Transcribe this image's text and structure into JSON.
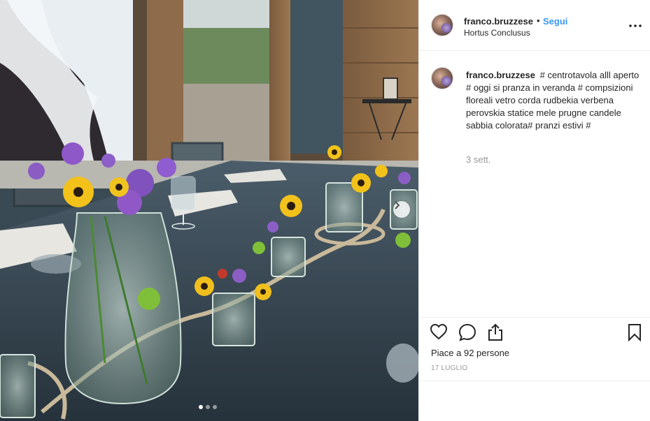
{
  "post": {
    "username": "franco.bruzzese",
    "separator": "•",
    "follow_label": "Segui",
    "location": "Hortus Conclusus",
    "more_icon": "ellipsis-icon"
  },
  "caption": {
    "username": "franco.bruzzese",
    "text": "# centrotavola alll aperto # oggi si pranza in veranda # compsizioni floreali vetro corda rudbekia verbena perovskia statice mele prugne candele sabbia colorata# pranzi estivi #",
    "age": "3 sett."
  },
  "actions": {
    "like_icon": "heart-icon",
    "comment_icon": "comment-icon",
    "share_icon": "share-icon",
    "save_icon": "bookmark-icon"
  },
  "likes": {
    "text": "Piace a 92 persone"
  },
  "date": "17 LUGLIO",
  "carousel": {
    "current": 1,
    "total": 3,
    "next_icon": "chevron-right-icon"
  },
  "colors": {
    "link_blue": "#3897f0",
    "muted": "#999999",
    "text": "#262626",
    "divider": "#efefef"
  }
}
